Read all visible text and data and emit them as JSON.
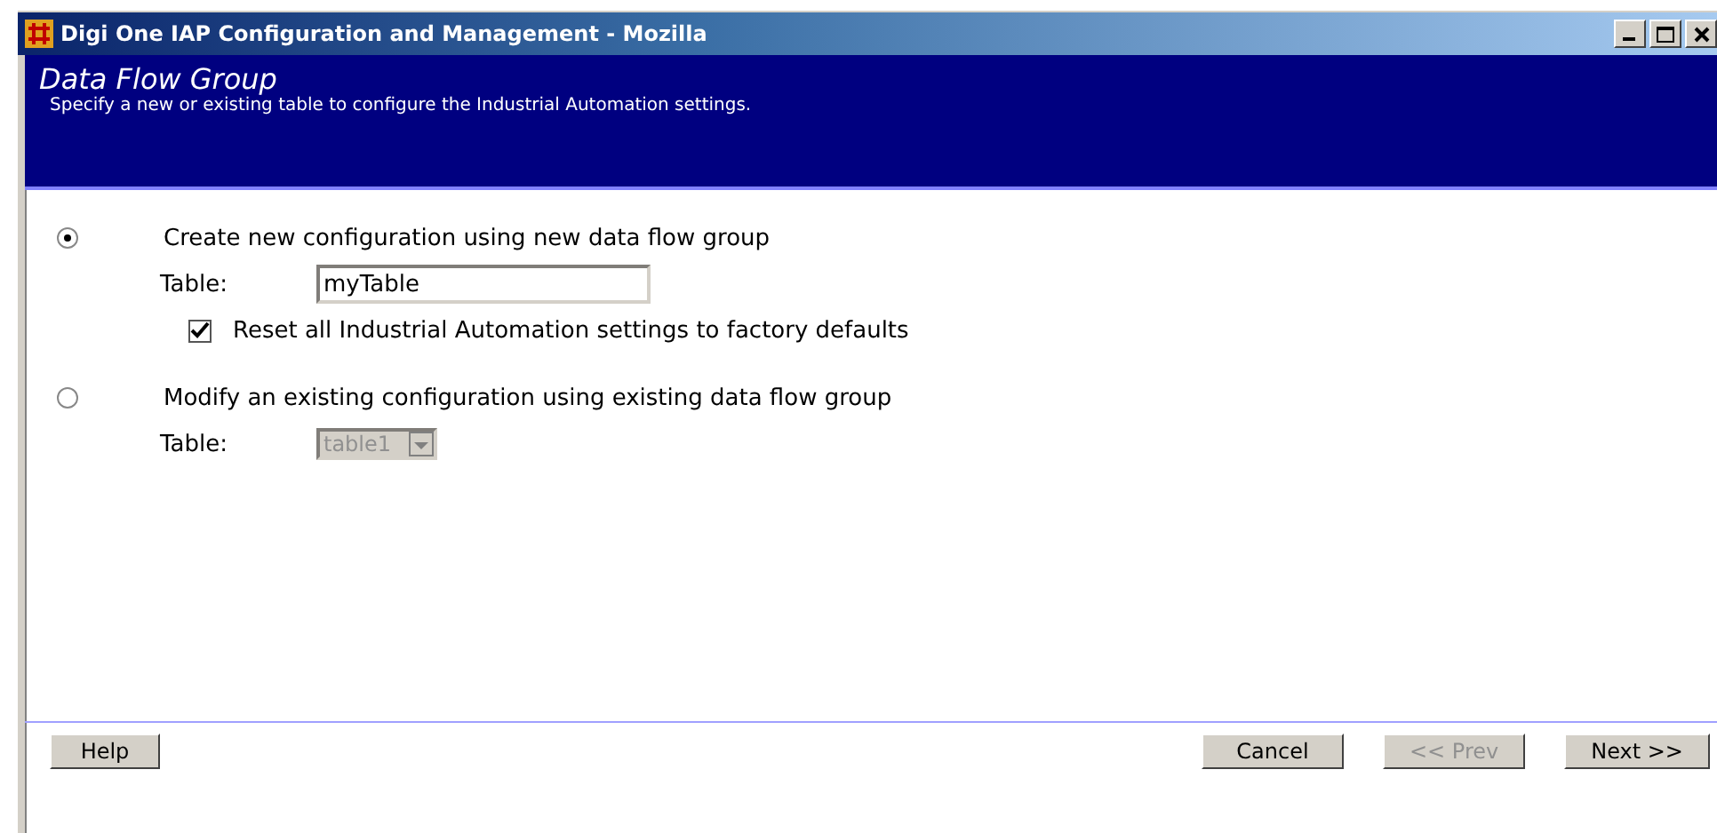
{
  "window": {
    "title": "Digi One IAP Configuration and Management - Mozilla"
  },
  "header": {
    "title": "Data Flow Group",
    "subtitle": "Specify a new or existing table to configure the Industrial Automation settings."
  },
  "options": [
    {
      "label": "Create new configuration using new data flow group",
      "selected": true,
      "table_label": "Table:",
      "kind": "input",
      "value": "myTable",
      "disabled": false,
      "checkbox": {
        "label": "Reset all Industrial Automation settings to factory defaults",
        "checked": true
      }
    },
    {
      "label": "Modify an existing configuration using existing data flow group",
      "selected": false,
      "table_label": "Table:",
      "kind": "select",
      "value": "table1",
      "disabled": true
    }
  ],
  "left_buttons": [
    {
      "label": "Help",
      "disabled": false
    }
  ],
  "right_buttons": [
    {
      "label": "Cancel",
      "disabled": false
    },
    {
      "label": "<< Prev",
      "disabled": true
    },
    {
      "label": "Next >>",
      "disabled": false
    }
  ]
}
